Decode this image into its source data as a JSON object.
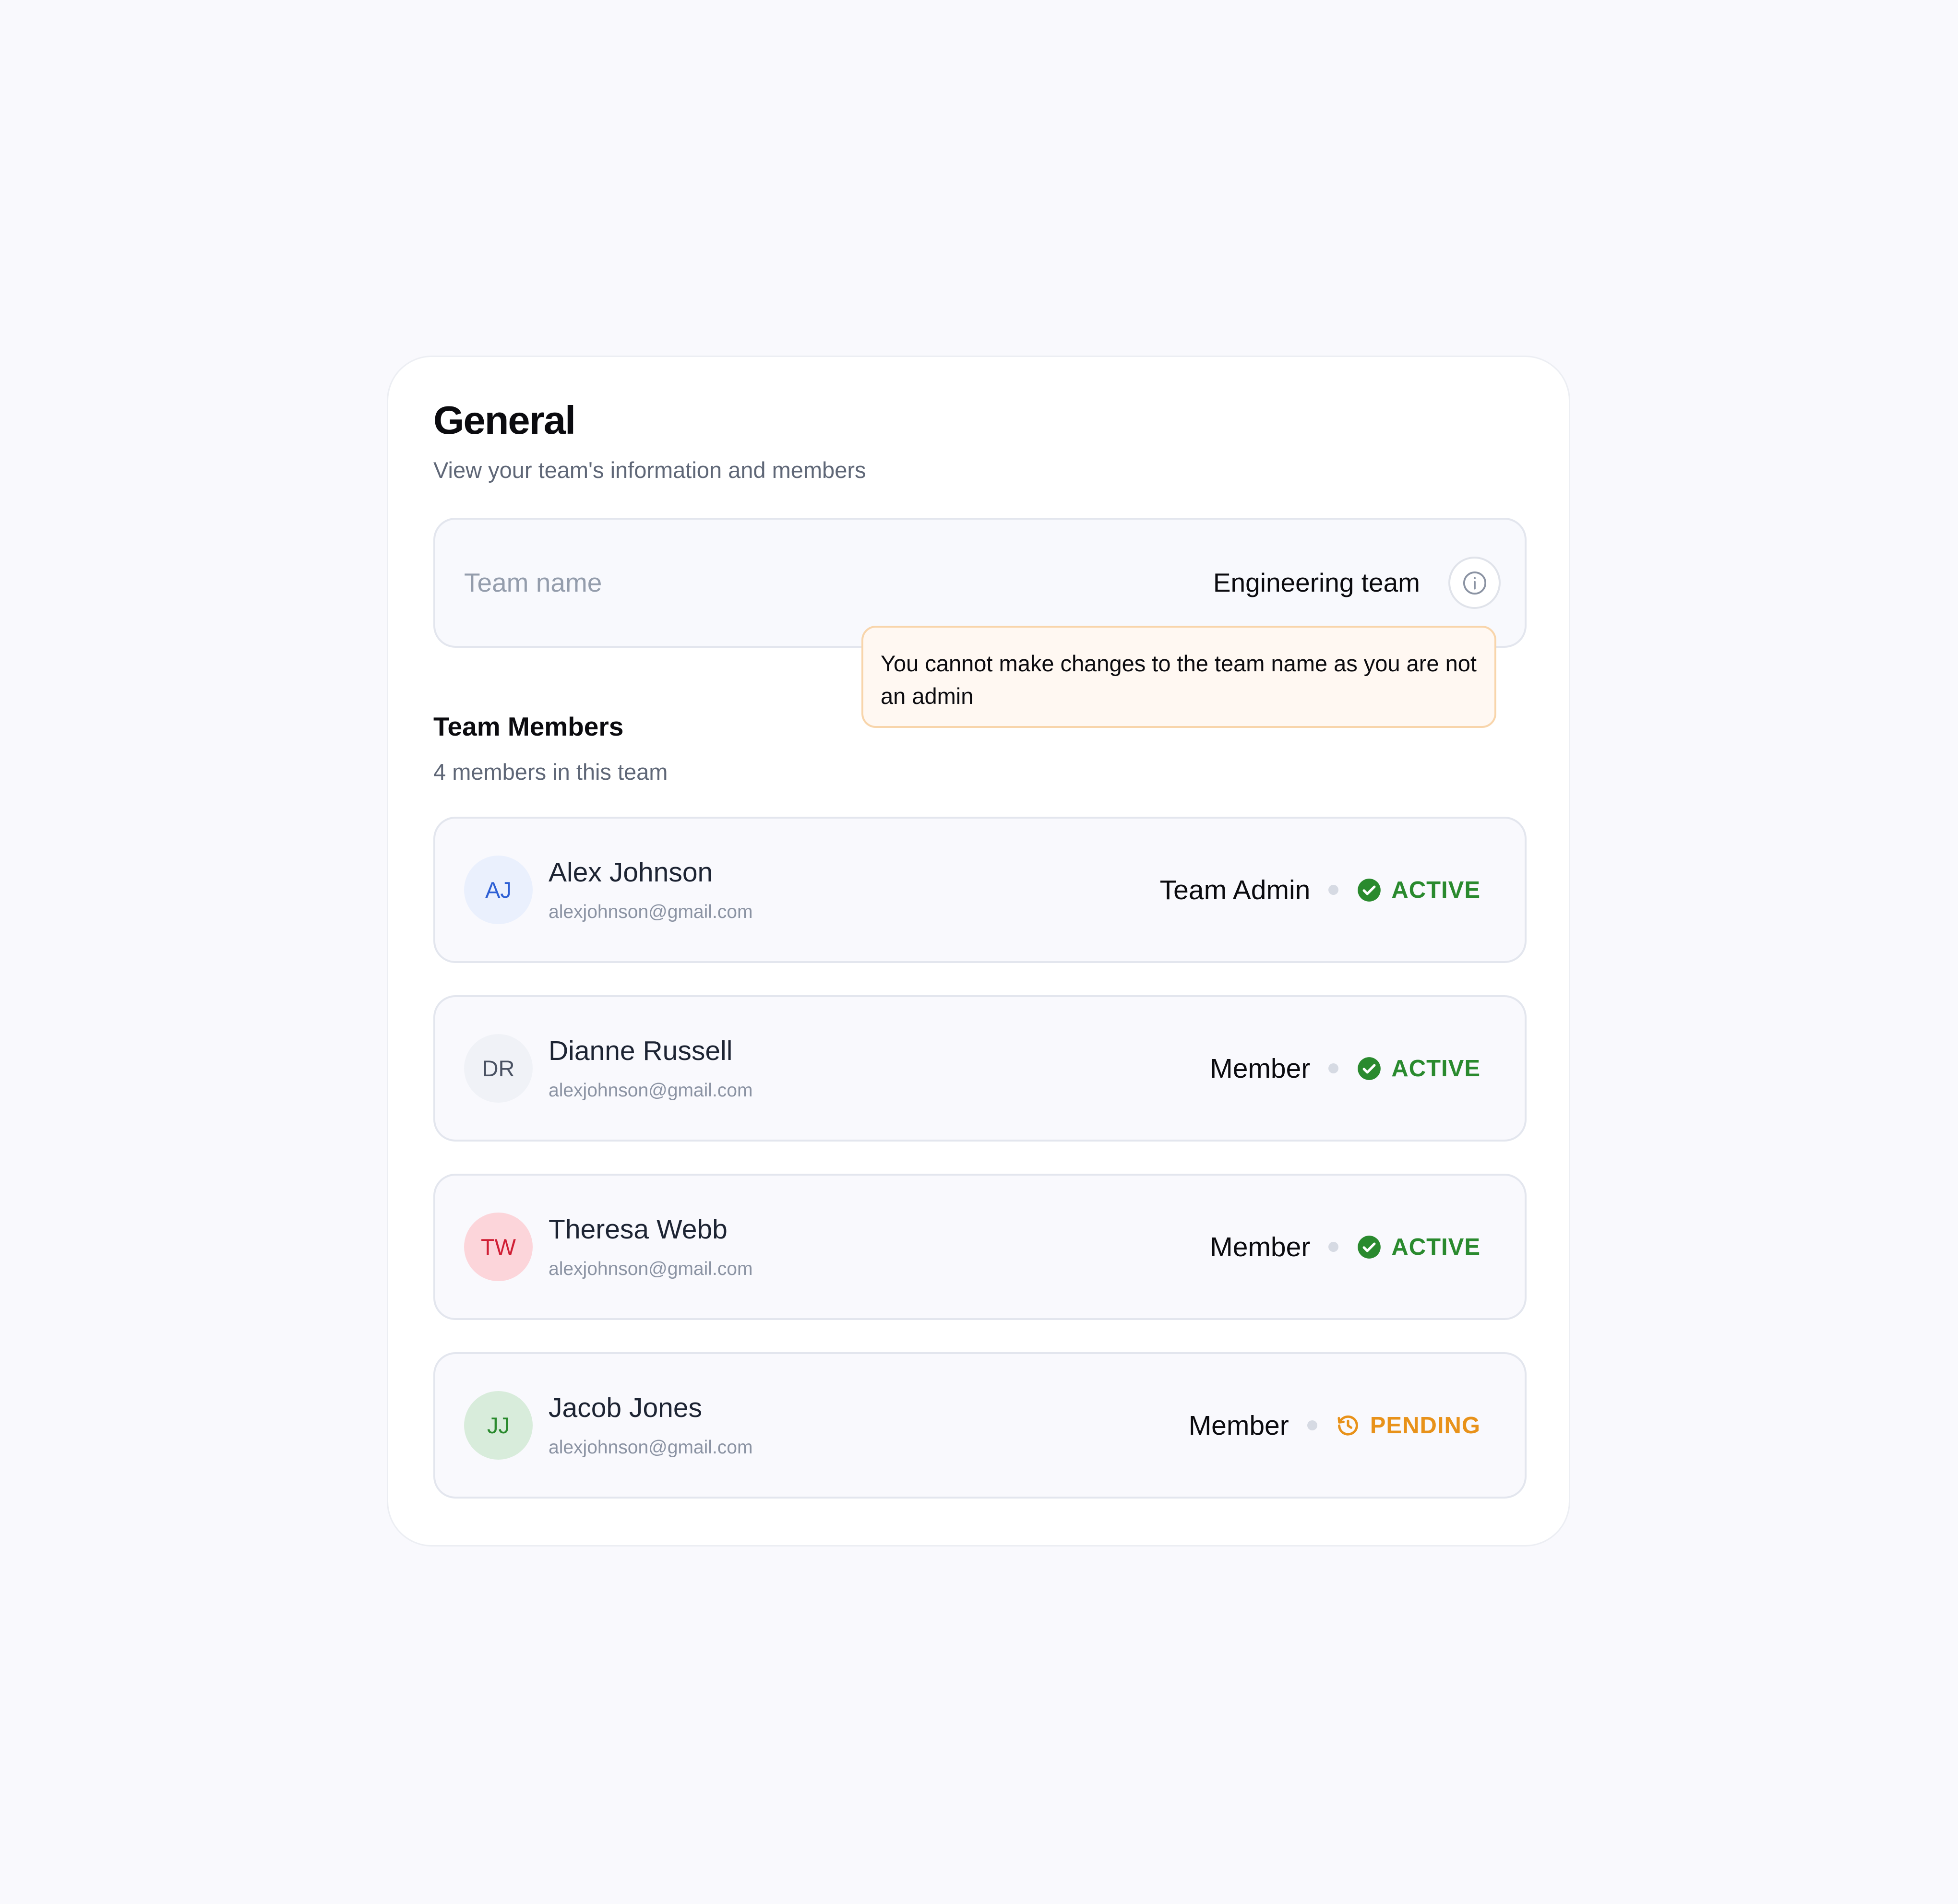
{
  "header": {
    "title": "General",
    "subtitle": "View your team's information and members"
  },
  "team_name": {
    "label": "Team name",
    "value": "Engineering team",
    "info_icon": "info-icon"
  },
  "tooltip": {
    "text": "You cannot make changes to the team name as you are not an admin"
  },
  "members_section": {
    "title": "Team Members",
    "subtitle": "4 members in this team"
  },
  "members": [
    {
      "initials": "AJ",
      "name": "Alex Johnson",
      "email": "alexjohnson@gmail.com",
      "role": "Team Admin",
      "status": "ACTIVE",
      "status_icon": "check-circle-icon",
      "avatar_bg": "#eaf0fd",
      "avatar_fg": "#2d5fd4",
      "status_color": "#2a8a2e"
    },
    {
      "initials": "DR",
      "name": "Dianne Russell",
      "email": "alexjohnson@gmail.com",
      "role": "Member",
      "status": "ACTIVE",
      "status_icon": "check-circle-icon",
      "avatar_bg": "#f0f2f7",
      "avatar_fg": "#4a5263",
      "status_color": "#2a8a2e"
    },
    {
      "initials": "TW",
      "name": "Theresa Webb",
      "email": "alexjohnson@gmail.com",
      "role": "Member",
      "status": "ACTIVE",
      "status_icon": "check-circle-icon",
      "avatar_bg": "#fcd5da",
      "avatar_fg": "#d01f35",
      "status_color": "#2a8a2e"
    },
    {
      "initials": "JJ",
      "name": "Jacob Jones",
      "email": "alexjohnson@gmail.com",
      "role": "Member",
      "status": "PENDING",
      "status_icon": "clock-history-icon",
      "avatar_bg": "#d8ecdb",
      "avatar_fg": "#2a8a2e",
      "status_color": "#e8921a"
    }
  ]
}
